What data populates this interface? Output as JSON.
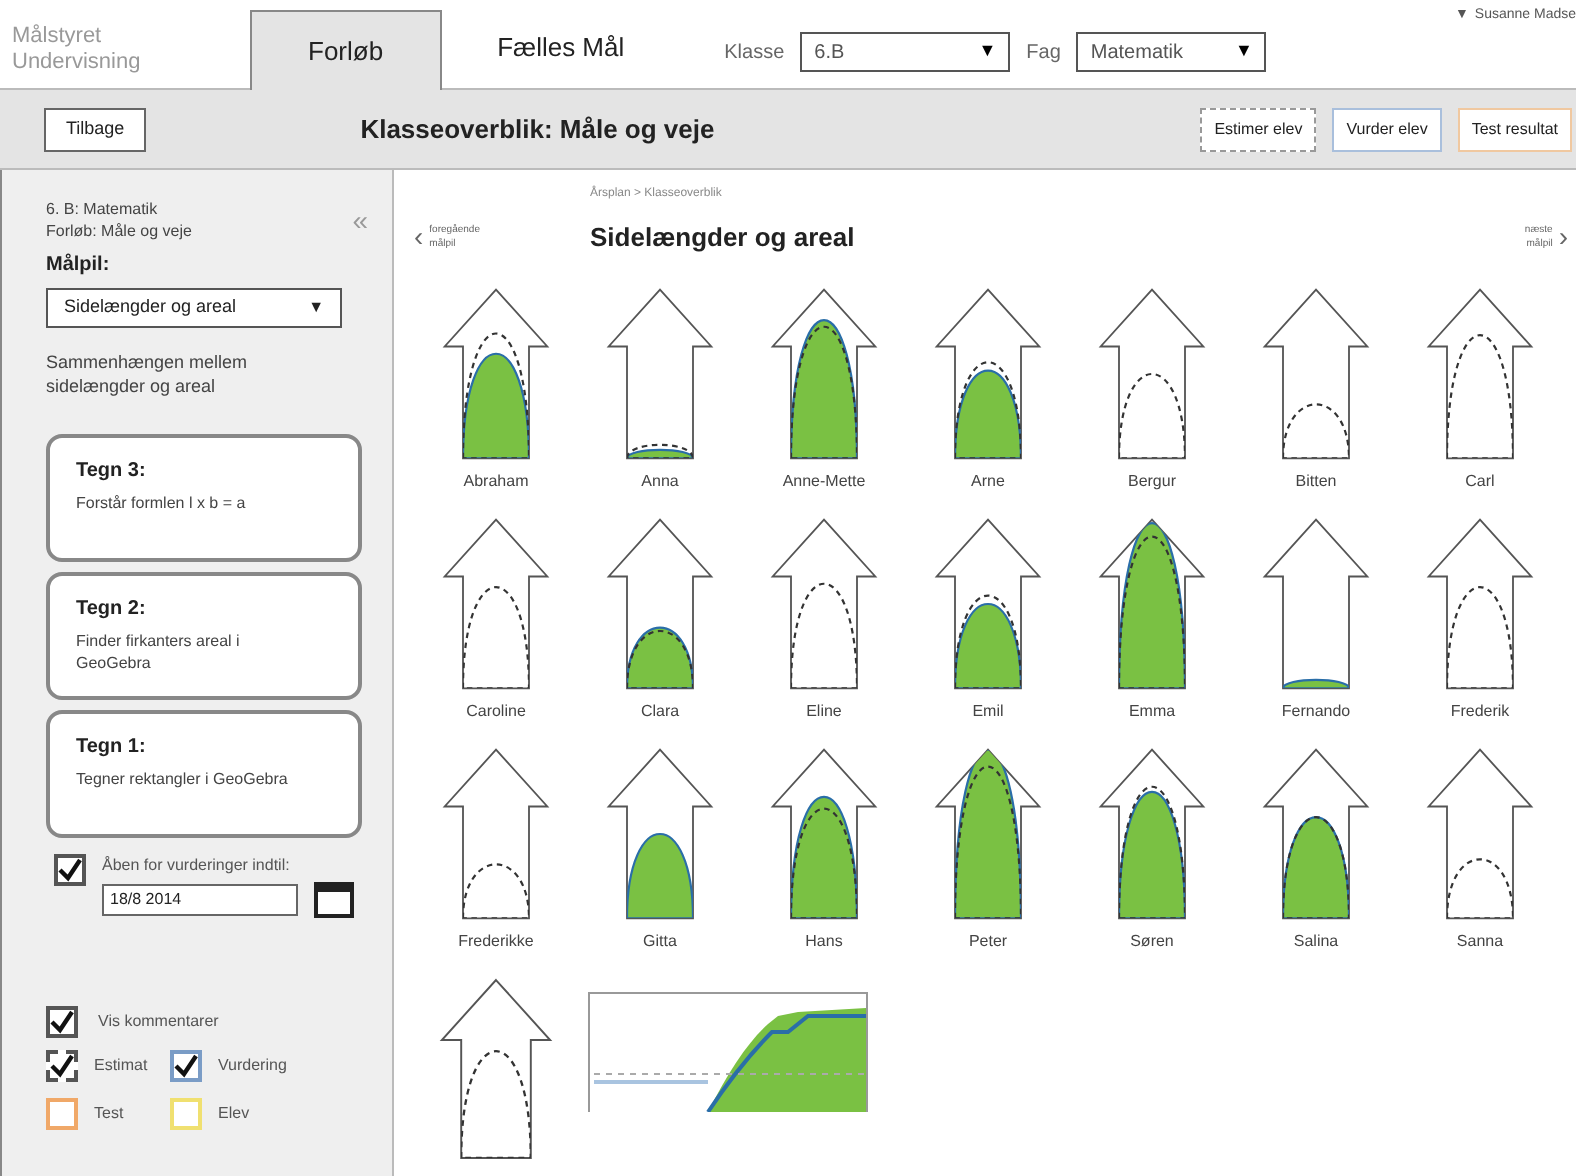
{
  "header": {
    "logo_lines": [
      "Målstyret",
      "Undervisning"
    ],
    "tabs": [
      {
        "label": "Forløb",
        "selected": true
      },
      {
        "label": "Fælles Mål",
        "selected": false
      }
    ],
    "class_select": {
      "label": "Klasse",
      "value": "6.B",
      "caret": "▼"
    },
    "subject_select": {
      "label": "Fag",
      "value": "Matematik",
      "caret": "▼"
    },
    "user": {
      "caret": "▼",
      "name": "Susanne Madse"
    }
  },
  "toolbar": {
    "back": "Tilbage",
    "title": "Klasseoverblik: Måle og veje",
    "buttons": [
      {
        "label": "Estimer elev",
        "kind": "dashed"
      },
      {
        "label": "Vurder elev",
        "kind": "blue"
      },
      {
        "label": "Test resultat",
        "kind": "orange"
      }
    ]
  },
  "sidebar": {
    "info_lines": [
      "6. B: Matematik",
      "Forløb: Måle og veje"
    ],
    "collapse": "«",
    "goal_label": "Målpil:",
    "goal_select": {
      "value": "Sidelængder og areal",
      "caret": "▼"
    },
    "description": "Sammenhængen mellem sidelængder og areal",
    "signs": [
      {
        "title": "Tegn 3:",
        "text": "Forstår formlen l x b = a"
      },
      {
        "title": "Tegn 2:",
        "text": "Finder firkanters areal i GeoGebra"
      },
      {
        "title": "Tegn 1:",
        "text": "Tegner rektangler i GeoGebra"
      }
    ],
    "open_for_assessment": {
      "label": "Åben for vurderinger indtil:",
      "checked": true,
      "date": "18/8 2014"
    },
    "show_comments": {
      "label": "Vis kommentarer",
      "checked": true
    },
    "legend": [
      {
        "label": "Estimat",
        "checked": true,
        "kind": "dashed",
        "color": "#555555"
      },
      {
        "label": "Vurdering",
        "checked": true,
        "kind": "solid",
        "color": "#7a9cc6"
      },
      {
        "label": "Test",
        "checked": false,
        "kind": "solid",
        "color": "#f0a868"
      },
      {
        "label": "Elev",
        "checked": false,
        "kind": "solid",
        "color": "#f0e070"
      }
    ]
  },
  "main": {
    "breadcrumb": "Årsplan > Klasseoverblik",
    "prev": {
      "arrow": "‹",
      "lines": [
        "foregående",
        "målpil"
      ]
    },
    "title": "Sidelængder og areal",
    "next": {
      "arrow": "›",
      "lines": [
        "næste",
        "målpil"
      ]
    },
    "students": [
      {
        "name": "Abraham",
        "assessment": {
          "level": 0.62
        },
        "estimate": {
          "level": 0.74
        }
      },
      {
        "name": "Anna",
        "assessment": {
          "level": 0.05
        },
        "estimate": {
          "level": 0.08
        }
      },
      {
        "name": "Anne-Mette",
        "assessment": {
          "level": 0.82
        },
        "estimate": {
          "level": 0.78
        }
      },
      {
        "name": "Arne",
        "assessment": {
          "level": 0.52
        },
        "estimate": {
          "level": 0.57
        }
      },
      {
        "name": "Bergur",
        "estimate": {
          "level": 0.5
        }
      },
      {
        "name": "Bitten",
        "estimate": {
          "level": 0.32
        }
      },
      {
        "name": "Carl",
        "estimate": {
          "level": 0.73
        }
      },
      {
        "name": "Caroline",
        "estimate": {
          "level": 0.6
        }
      },
      {
        "name": "Clara",
        "assessment": {
          "level": 0.36
        },
        "estimate": {
          "level": 0.34
        }
      },
      {
        "name": "Eline",
        "estimate": {
          "level": 0.62
        }
      },
      {
        "name": "Emil",
        "assessment": {
          "level": 0.5
        },
        "estimate": {
          "level": 0.55
        }
      },
      {
        "name": "Emma",
        "assessment": {
          "level": 0.98
        },
        "estimate": {
          "level": 0.9
        }
      },
      {
        "name": "Fernando",
        "assessment": {
          "level": 0.05
        }
      },
      {
        "name": "Frederik",
        "estimate": {
          "level": 0.6
        }
      },
      {
        "name": "Frederikke",
        "estimate": {
          "level": 0.32
        }
      },
      {
        "name": "Gitta",
        "assessment": {
          "level": 0.5
        }
      },
      {
        "name": "Hans",
        "assessment": {
          "level": 0.72
        },
        "estimate": {
          "level": 0.65
        }
      },
      {
        "name": "Peter",
        "assessment": {
          "level": 1.0
        },
        "estimate": {
          "level": 0.9
        }
      },
      {
        "name": "Søren",
        "assessment": {
          "level": 0.75
        },
        "estimate": {
          "level": 0.78
        }
      },
      {
        "name": "Salina",
        "assessment": {
          "level": 0.6
        },
        "estimate": {
          "level": 0.6
        }
      },
      {
        "name": "Sanna",
        "estimate": {
          "level": 0.35
        }
      },
      {
        "estimate": {
          "level": 0.6
        }
      }
    ]
  }
}
